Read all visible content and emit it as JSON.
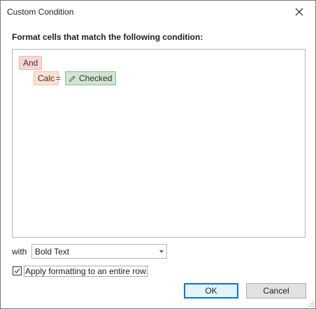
{
  "window": {
    "title": "Custom Condition",
    "close_icon": "close-icon"
  },
  "heading": "Format cells that match the following condition:",
  "condition": {
    "group_operator": "And",
    "field": "Calc",
    "operator": "=",
    "value": "Checked",
    "value_icon": "pencil-icon"
  },
  "colors": {
    "and_chip": "#f9d6d6",
    "field_chip": "#fde0d0",
    "value_chip": "#cfe5cf",
    "ok_border": "#0078d7"
  },
  "format": {
    "with_label": "with",
    "selected_style": "Bold Text"
  },
  "apply_row": {
    "label": "Apply formatting to an entire row",
    "checked": true
  },
  "buttons": {
    "ok": "OK",
    "cancel": "Cancel"
  }
}
